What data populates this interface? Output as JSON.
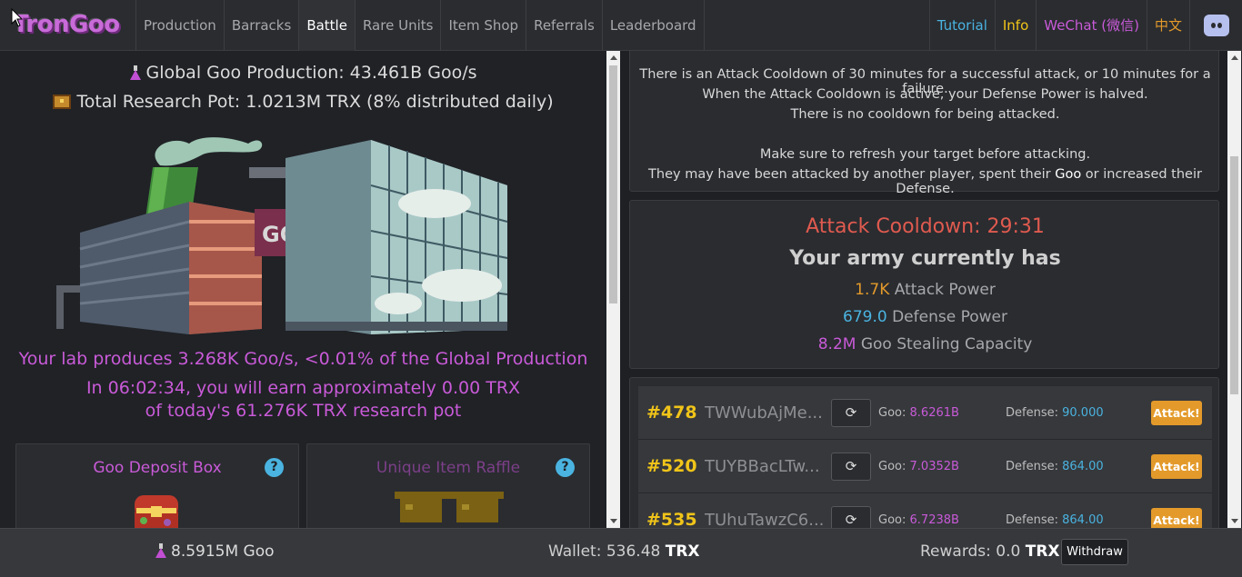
{
  "nav": {
    "logo": "TronGoo",
    "items": [
      "Production",
      "Barracks",
      "Battle",
      "Rare Units",
      "Item Shop",
      "Referrals",
      "Leaderboard"
    ],
    "active": "Battle",
    "right": [
      {
        "label": "Tutorial",
        "color": "#4ab3e0"
      },
      {
        "label": "Info",
        "color": "#f0c419"
      },
      {
        "label": "WeChat (微信)",
        "color": "#c95ad8"
      },
      {
        "label": "中文",
        "color": "#e39a2b"
      }
    ]
  },
  "left": {
    "global_production": "Global Goo Production: 43.461B Goo/s",
    "research_pot": "Total Research Pot: 1.0213M TRX (8% distributed daily)",
    "lab_line": "Your lab produces 3.268K Goo/s, <0.01% of the Global Production",
    "earn_line1": "In 06:02:34, you will earn approximately 0.00 TRX",
    "earn_line2": "of today's 61.276K TRX research pot",
    "deposit_title": "Goo Deposit Box",
    "raffle_title": "Unique Item Raffle",
    "help": "?"
  },
  "info": {
    "lines": [
      "There is an Attack Cooldown of 30 minutes for a successful attack, or 10 minutes for a failure.",
      "When the Attack Cooldown is active, your Defense Power is halved.",
      "There is no cooldown for being attacked."
    ],
    "refresh_line": "Make sure to refresh your target before attacking.",
    "last_prefix": "They may have been attacked by another player, spent their ",
    "last_goo": "Goo",
    "last_suffix": " or increased their Defense."
  },
  "army": {
    "cooldown": "Attack Cooldown: 29:31",
    "heading": "Your army currently has",
    "attack_value": "1.7K",
    "attack_label": "Attack Power",
    "defense_value": "679.0",
    "defense_label": "Defense Power",
    "steal_value": "8.2M",
    "steal_label": "Goo Stealing Capacity"
  },
  "targets": [
    {
      "rank": "#478",
      "address": "TWWubAjMe...",
      "goo_label": "Goo:",
      "goo": "8.6261B",
      "def_label": "Defense:",
      "defense": "90.000",
      "button": "Attack!"
    },
    {
      "rank": "#520",
      "address": "TUYBBacLTw...",
      "goo_label": "Goo:",
      "goo": "7.0352B",
      "def_label": "Defense:",
      "defense": "864.00",
      "button": "Attack!"
    },
    {
      "rank": "#535",
      "address": "TUhuTawzC6...",
      "goo_label": "Goo:",
      "goo": "6.7238B",
      "def_label": "Defense:",
      "defense": "864.00",
      "button": "Attack!"
    }
  ],
  "footer": {
    "goo": "8.5915M Goo",
    "wallet_label": "Wallet: 536.48 ",
    "wallet_unit": "TRX",
    "rewards_label": "Rewards: 0.0 ",
    "rewards_unit": "TRX",
    "withdraw": "Withdraw"
  },
  "colors": {
    "purple": "#c95ad8",
    "orange": "#e39a2b",
    "blue": "#4ab3e0",
    "yellow": "#f0c419",
    "red": "#e05a4f"
  }
}
